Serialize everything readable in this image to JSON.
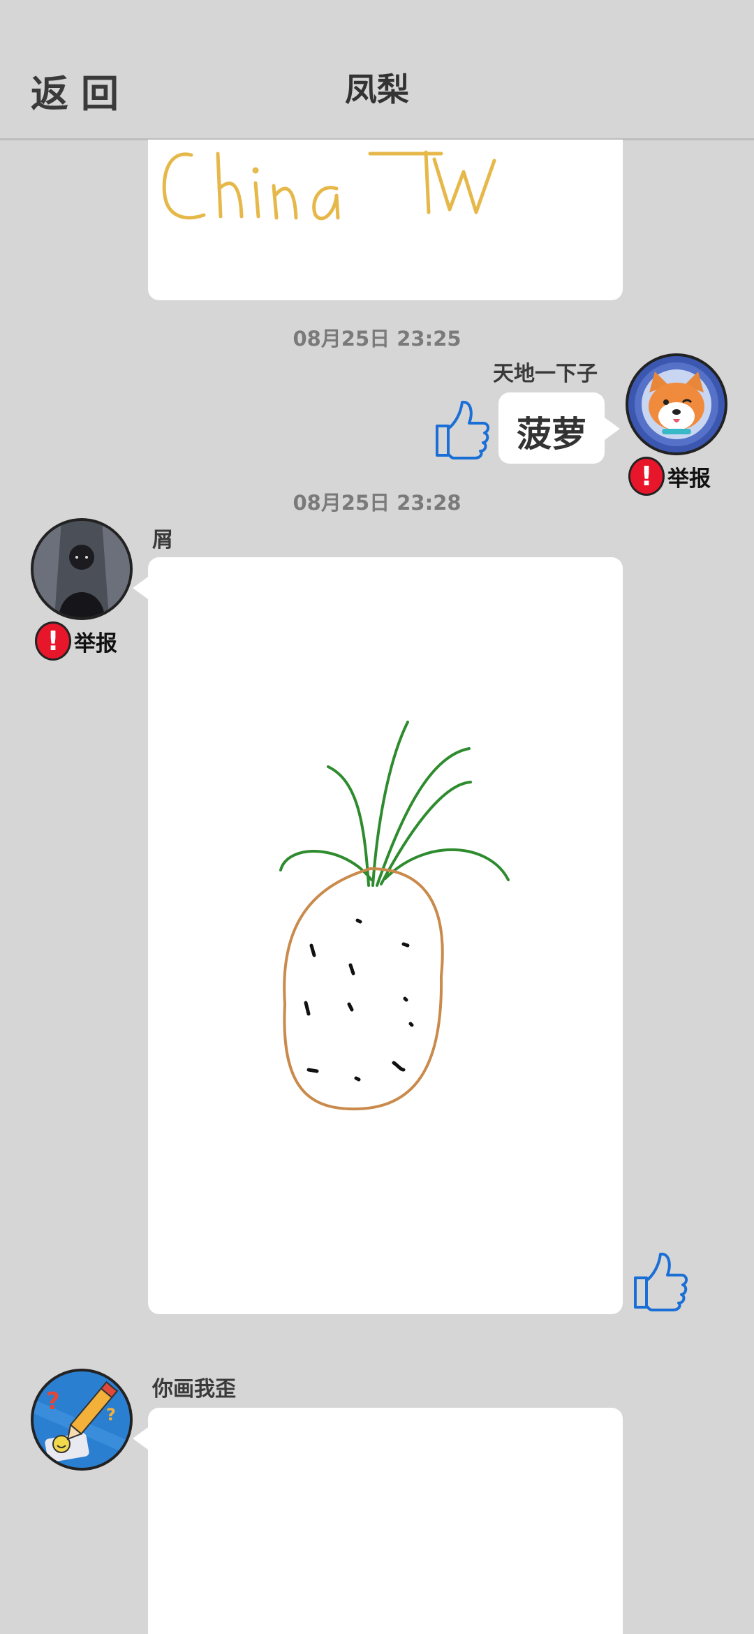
{
  "header": {
    "back_label": "返回",
    "title": "凤梨"
  },
  "messages": [
    {
      "type": "drawing",
      "text_drawn": "ChinaTW"
    },
    {
      "timestamp": "08月25日  23:25",
      "username": "天地一下子",
      "text": "菠萝",
      "report_label": "举报"
    },
    {
      "timestamp": "08月25日  23:28",
      "username": "屑",
      "report_label": "举报"
    },
    {
      "username": "你画我歪"
    }
  ],
  "icons": {
    "like": "thumbs-up-icon",
    "report": "report-exclamation-icon"
  },
  "colors": {
    "background": "#d6d6d6",
    "like_blue": "#1a6fd6",
    "report_red": "#e8162b",
    "sketch_yellow": "#e6b84a",
    "pineapple_green": "#2e8b2e",
    "pineapple_brown": "#c98a4b"
  }
}
